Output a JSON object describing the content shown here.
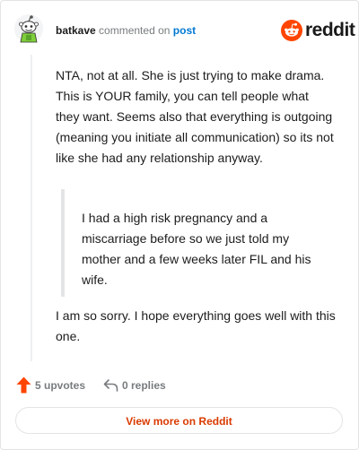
{
  "header": {
    "username": "batkave",
    "action_text": "commented on",
    "post_link": "post",
    "logo_text": "reddit"
  },
  "comment": {
    "body": "NTA, not at all. She is just trying to make drama. This is YOUR family, you can tell people what they want. Seems also that everything is outgoing (meaning you initiate all communication) so its not like she had any relationship anyway.",
    "quote": "I had a high risk pregnancy and a miscarriage before so we just told my mother and a few weeks later FIL and his wife.",
    "reply": "I am so sorry. I hope everything goes well with this one."
  },
  "actions": {
    "upvotes_label": "5 upvotes",
    "replies_label": "0 replies"
  },
  "footer": {
    "view_more_label": "View more on Reddit"
  },
  "colors": {
    "brand": "#ff4500",
    "link": "#0079d3",
    "cta": "#d93a00",
    "muted": "#787c7e"
  },
  "icons": {
    "avatar": "snoo-avatar-icon",
    "logo": "reddit-logo-icon",
    "upvote": "upvote-arrow-icon",
    "reply": "reply-arrow-icon"
  }
}
